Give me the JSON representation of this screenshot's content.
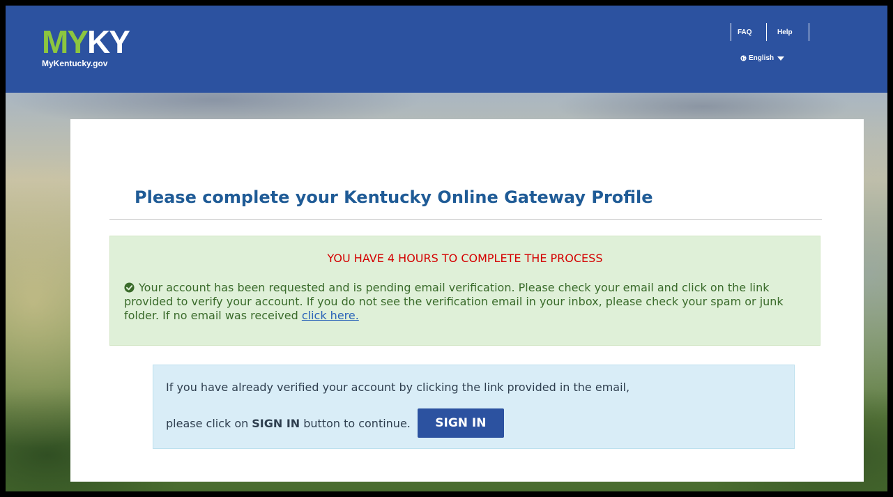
{
  "header": {
    "logo": {
      "my": "MY",
      "ky": "KY",
      "subtitle": "MyKentucky.gov"
    },
    "nav": {
      "faq": "FAQ",
      "help": "Help"
    },
    "language": {
      "label": "English",
      "icon": "globe-icon"
    }
  },
  "main": {
    "title": "Please complete your Kentucky Online Gateway Profile",
    "alert": {
      "heading": "YOU HAVE 4 HOURS TO COMPLETE THE PROCESS",
      "icon": "check-circle-icon",
      "message": "Your account has been requested and is pending email verification. Please check your email and click on the link provided to verify your account. If you do not see the verification email in your inbox, please check your spam or junk folder. If no email was received",
      "link_text": "click here."
    },
    "info": {
      "line1": "If you have already verified your account by clicking the link provided in the email,",
      "line2_prefix": "please click on",
      "line2_bold": "SIGN IN",
      "line2_suffix": "button to continue.",
      "button_label": "SIGN IN"
    }
  },
  "colors": {
    "header_bg": "#2c52a0",
    "logo_green": "#8cc63f",
    "title_blue": "#1f5b96",
    "alert_bg": "#dff0d8",
    "alert_heading": "#d40000",
    "alert_text": "#3a6b2b",
    "info_bg": "#d9edf7",
    "button_bg": "#2c52a0"
  }
}
